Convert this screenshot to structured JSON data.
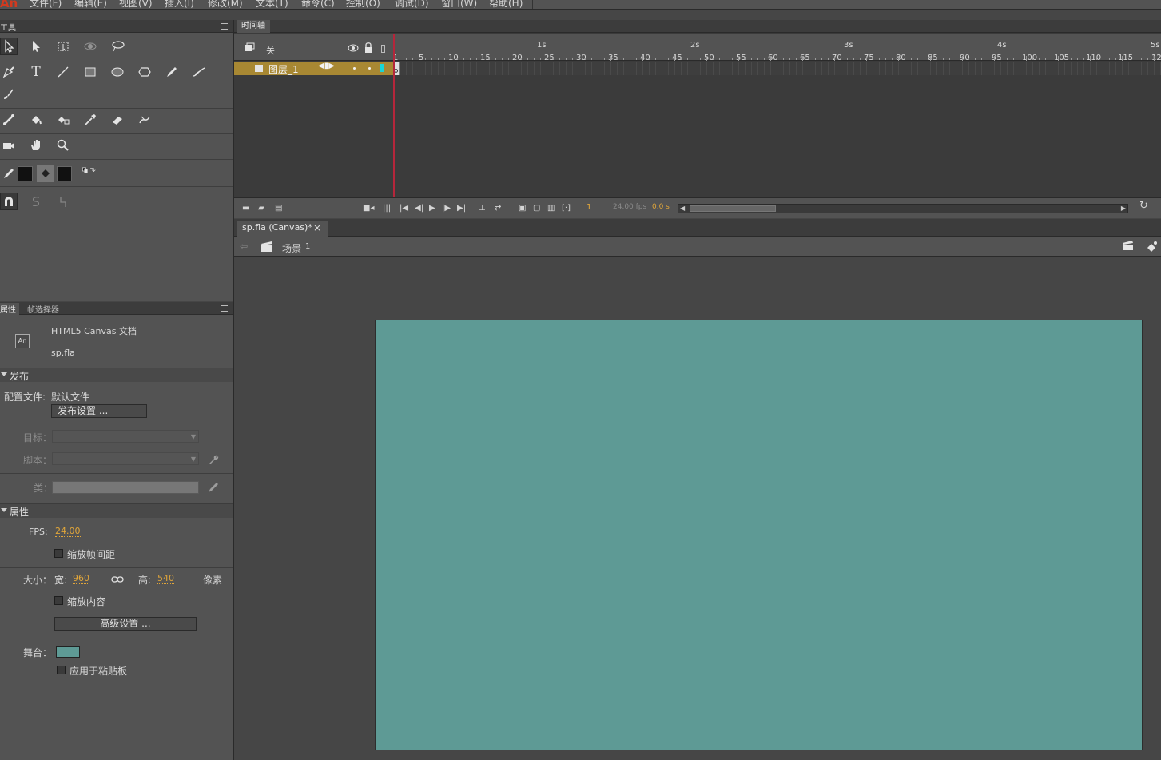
{
  "app": {
    "logo": "An"
  },
  "menu": [
    "文件(F)",
    "编辑(E)",
    "视图(V)",
    "插入(I)",
    "修改(M)",
    "文本(T)",
    "命令(C)",
    "控制(O)",
    "调试(D)",
    "窗口(W)",
    "帮助(H)"
  ],
  "tools_panel": {
    "title": "工具"
  },
  "timeline": {
    "tab": "时间轴",
    "header_label": "关",
    "layer_name": "图层_1",
    "seconds": [
      "1s",
      "2s",
      "3s",
      "4s",
      "5s"
    ],
    "frames": [
      "1",
      "5",
      "10",
      "15",
      "20",
      "25",
      "30",
      "35",
      "40",
      "45",
      "50",
      "55",
      "60",
      "65",
      "70",
      "75",
      "80",
      "85",
      "90",
      "95",
      "100",
      "105",
      "110",
      "115",
      "12"
    ],
    "current_frame": "1",
    "fps": "24.00 fps",
    "time": "0.0 s",
    "scroll_thumb_fraction": 0.2
  },
  "document": {
    "tab": "sp.fla (Canvas)*",
    "close": "×",
    "scene_label": "场景",
    "scene_number": "1"
  },
  "properties": {
    "tab_props": "属性",
    "tab_frame_picker": "帧选择器",
    "doc_type": "HTML5 Canvas 文档",
    "file_name": "sp.fla",
    "doc_icon": "An",
    "publish": {
      "section": "发布",
      "profile_label": "配置文件:",
      "profile_value": "默认文件",
      "settings_button": "发布设置 ...",
      "target_label": "目标：",
      "script_label": "脚本：",
      "class_label": "类："
    },
    "props_section": {
      "section": "属性",
      "fps_label": "FPS:",
      "fps_value": "24.00",
      "scale_interval": "缩放帧间距",
      "size_label": "大小：",
      "width_label": "宽:",
      "width_value": "960",
      "height_label": "高:",
      "height_value": "540",
      "unit": "像素",
      "scale_content": "缩放内容",
      "advanced_button": "高级设置 ...",
      "stage_label": "舞台：",
      "stage_color": "#5e9a95",
      "apply_pasteboard": "应用于粘贴板"
    }
  },
  "icons": [
    "selection-tool-icon",
    "subselection-tool-icon",
    "free-transform-icon",
    "3d-rotation-icon",
    "lasso-icon",
    "pen-icon",
    "text-tool-icon",
    "line-tool-icon",
    "rectangle-tool-icon",
    "oval-tool-icon",
    "polystar-icon",
    "pencil-icon",
    "brush-icon",
    "paint-brush-icon",
    "bone-tool-icon",
    "paint-bucket-icon",
    "ink-bottle-icon",
    "eyedropper-icon",
    "eraser-icon",
    "width-tool-icon",
    "camera-icon",
    "hand-icon",
    "zoom-icon",
    "stroke-color-icon",
    "fill-color-icon",
    "swap-colors-icon",
    "snap-icon"
  ]
}
